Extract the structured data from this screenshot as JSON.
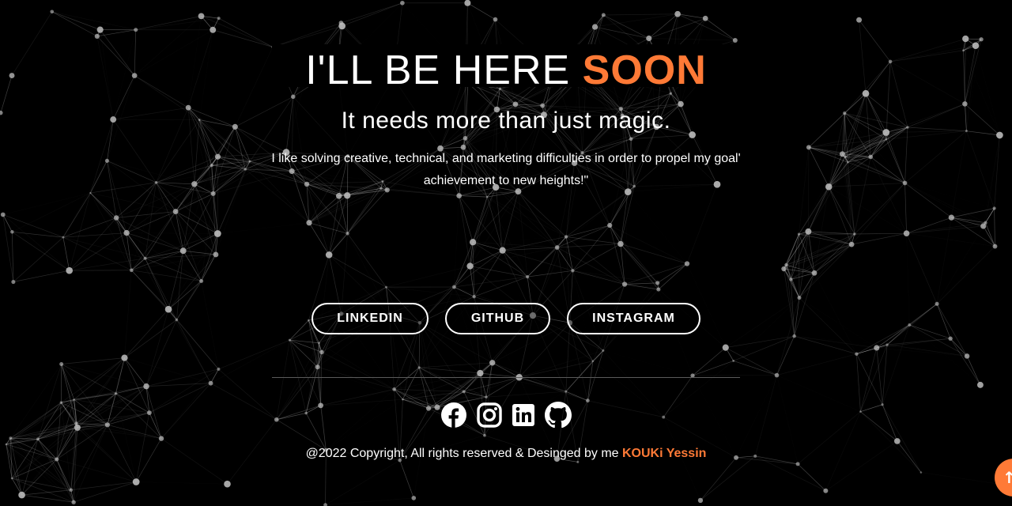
{
  "hero": {
    "headline_main": "I'LL BE HERE ",
    "headline_accent": "SOON",
    "subtitle": "It needs more than just magic.",
    "description": "I like solving creative, technical, and marketing difficulties in order to propel my goal' achievement to new heights!\""
  },
  "buttons": {
    "linkedin": "LINKEDIN",
    "github": "GITHUB",
    "instagram": "INSTAGRAM"
  },
  "social": [
    {
      "icon": "facebook-icon"
    },
    {
      "icon": "instagram-icon"
    },
    {
      "icon": "linkedin-icon"
    },
    {
      "icon": "github-icon"
    }
  ],
  "footer": {
    "copyright": "@2022 Copyright, All rights reserved & Desinged by me ",
    "author": "KOUKi Yessin"
  },
  "colors": {
    "background": "#000000",
    "accent": "#ff7a36",
    "text": "#ffffff"
  },
  "fab": {
    "icon": "arrow-up-icon"
  }
}
